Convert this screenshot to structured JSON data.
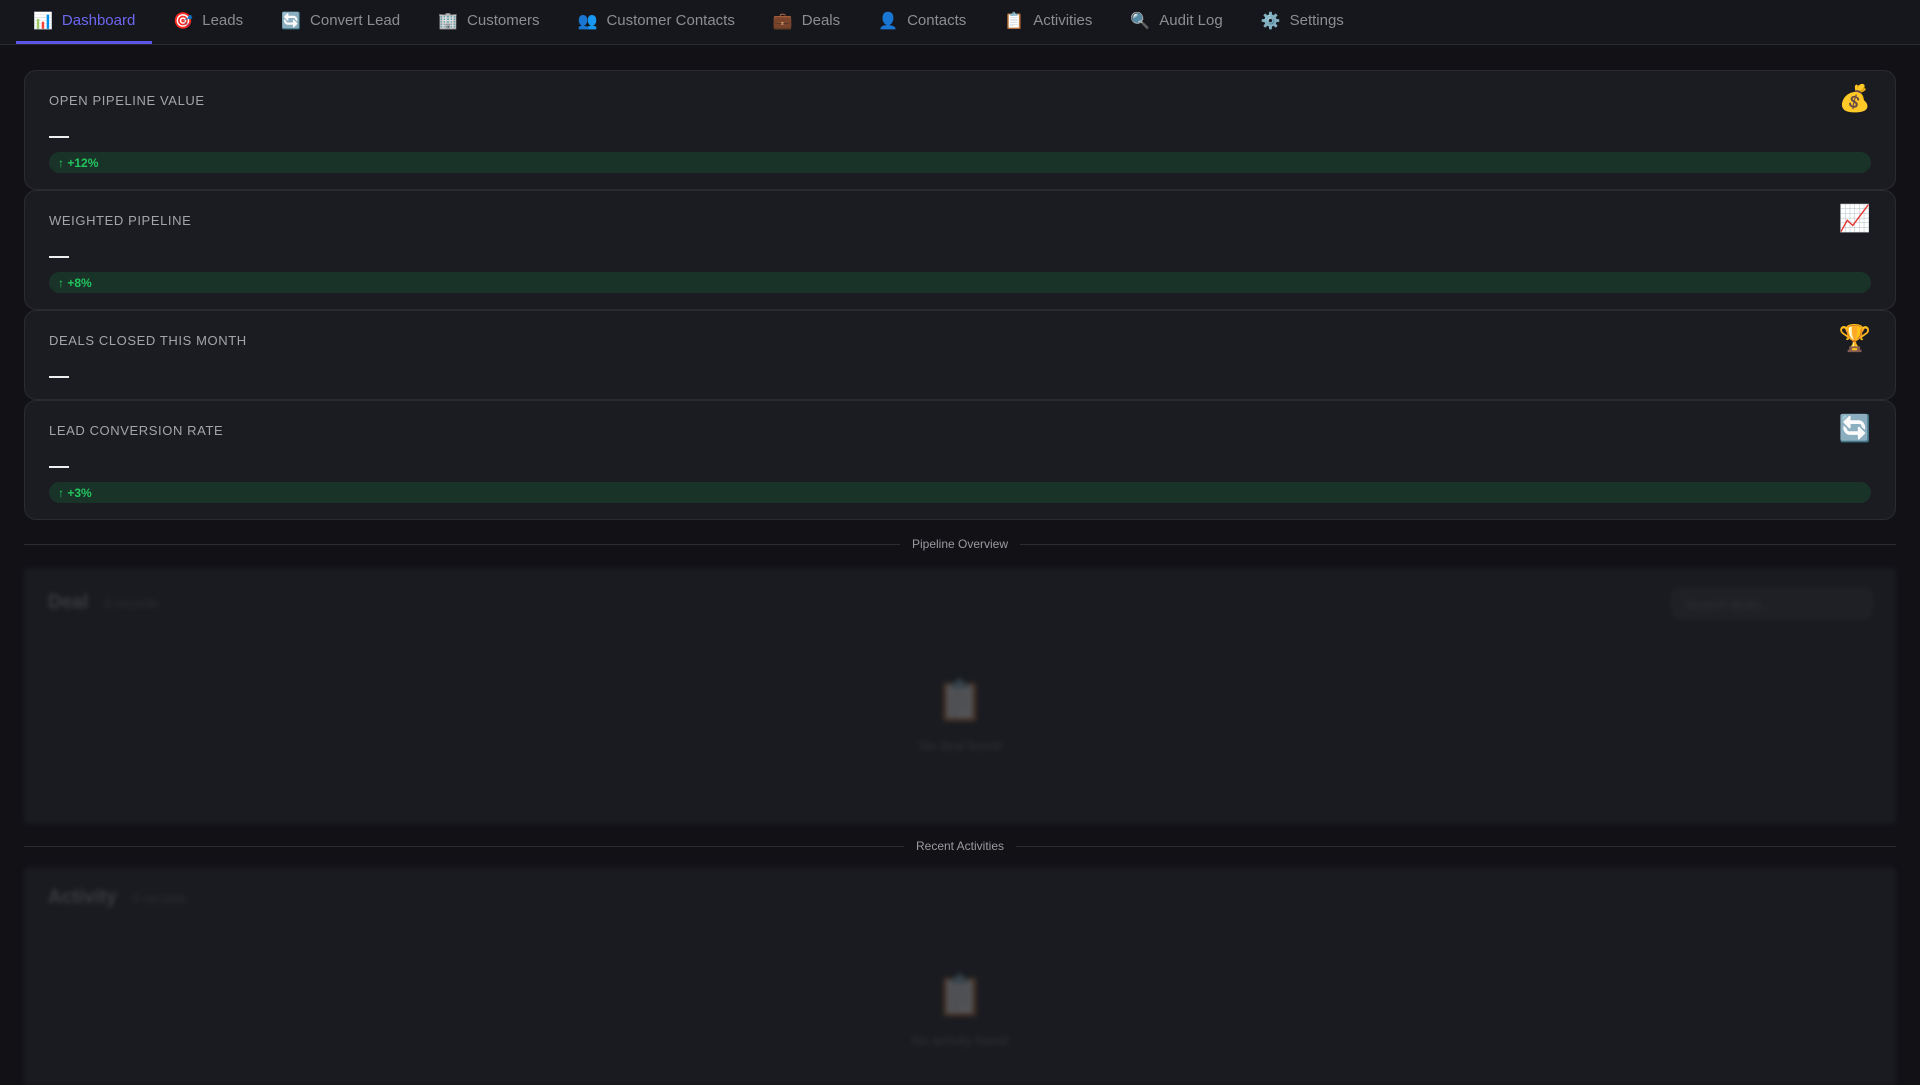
{
  "nav": {
    "tabs": [
      {
        "label": "Dashboard",
        "icon": "📊",
        "name": "dashboard"
      },
      {
        "label": "Leads",
        "icon": "🎯",
        "name": "leads"
      },
      {
        "label": "Convert Lead",
        "icon": "🔄",
        "name": "convert-lead"
      },
      {
        "label": "Customers",
        "icon": "🏢",
        "name": "customers"
      },
      {
        "label": "Customer Contacts",
        "icon": "👥",
        "name": "customer-contacts"
      },
      {
        "label": "Deals",
        "icon": "💼",
        "name": "deals"
      },
      {
        "label": "Contacts",
        "icon": "👤",
        "name": "contacts"
      },
      {
        "label": "Activities",
        "icon": "📋",
        "name": "activities"
      },
      {
        "label": "Audit Log",
        "icon": "🔍",
        "name": "audit-log"
      },
      {
        "label": "Settings",
        "icon": "⚙️",
        "name": "settings"
      }
    ],
    "active": "Dashboard"
  },
  "metrics": [
    {
      "label": "OPEN PIPELINE VALUE",
      "value": "—",
      "icon": "💰",
      "trend": "↑ +12%"
    },
    {
      "label": "WEIGHTED PIPELINE",
      "value": "—",
      "icon": "📈",
      "trend": "↑ +8%"
    },
    {
      "label": "DEALS CLOSED THIS MONTH",
      "value": "—",
      "icon": "🏆"
    },
    {
      "label": "LEAD CONVERSION RATE",
      "value": "—",
      "icon": "🔄",
      "trend": "↑ +3%"
    }
  ],
  "sections": {
    "pipeline": {
      "divider": "Pipeline Overview",
      "title": "Deal",
      "count": "0 records",
      "search_placeholder": "Search deals...",
      "empty_icon": "📋",
      "empty_text": "No deal found"
    },
    "activities": {
      "divider": "Recent Activities",
      "title": "Activity",
      "count": "0 records",
      "empty_icon": "📋",
      "empty_text": "No activity found"
    }
  },
  "colors": {
    "accent": "#5b56e8",
    "trend": "#22c55e",
    "trend_bg": "#1a3329"
  }
}
